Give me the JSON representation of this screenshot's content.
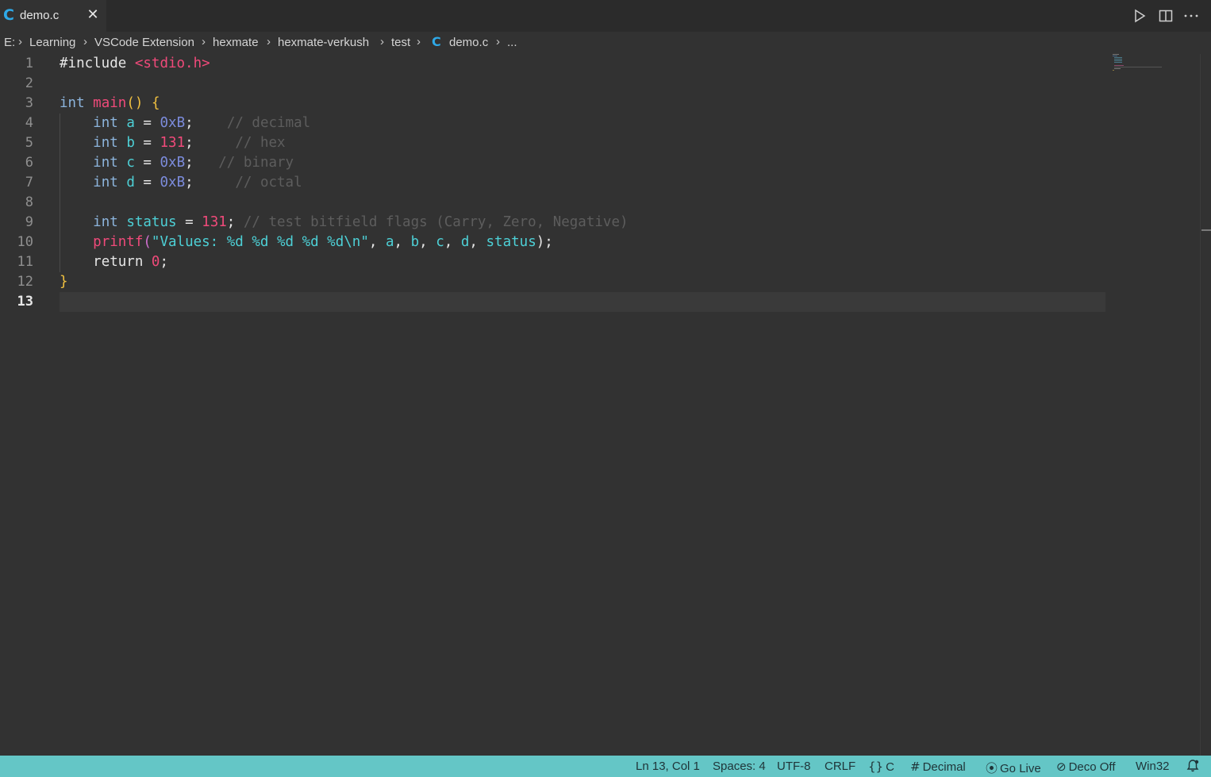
{
  "tab": {
    "icon_glyph": "C",
    "label": "demo.c",
    "close_glyph": "✕"
  },
  "breadcrumb": [
    "E:",
    "Learning",
    "VSCode Extension",
    "hexmate",
    "hexmate-verkush",
    "test",
    "demo.c",
    "..."
  ],
  "breadcrumb_file_icon": "C",
  "breadcrumb_separator": "›",
  "editor": {
    "line_numbers": [
      "1",
      "2",
      "3",
      "4",
      "5",
      "6",
      "7",
      "8",
      "9",
      "10",
      "11",
      "12",
      "13"
    ],
    "active_line": "13"
  },
  "code": {
    "l1_directive": "#include",
    "l1_header": "<stdio.h>",
    "l3_type": "int",
    "l3_fn": "main",
    "l3_parens": "()",
    "l3_brace": "{",
    "l4_type": "int",
    "l4_var": "a",
    "l4_eq": "=",
    "l4_val": "0xB",
    "l4_semi": ";",
    "l4_comment": "// decimal",
    "l5_type": "int",
    "l5_var": "b",
    "l5_eq": "=",
    "l5_val": "131",
    "l5_semi": ";",
    "l5_comment": "// hex",
    "l6_type": "int",
    "l6_var": "c",
    "l6_eq": "=",
    "l6_val": "0xB",
    "l6_semi": ";",
    "l6_comment": "// binary",
    "l7_type": "int",
    "l7_var": "d",
    "l7_eq": "=",
    "l7_val": "0xB",
    "l7_semi": ";",
    "l7_comment": "// octal",
    "l9_type": "int",
    "l9_var": "status",
    "l9_eq": "=",
    "l9_val": "131",
    "l9_semi": ";",
    "l9_comment": "// test bitfield flags (Carry, Zero, Negative)",
    "l10_fn": "printf",
    "l10_paren_open": "(",
    "l10_str": "\"Values: %d %d %d %d %d\\n\"",
    "l10_comma1": ",",
    "l10_a": "a",
    "l10_comma2": ",",
    "l10_b": "b",
    "l10_comma3": ",",
    "l10_c": "c",
    "l10_comma4": ",",
    "l10_d": "d",
    "l10_comma5": ",",
    "l10_status": "status",
    "l10_close": ");",
    "l11_return": "return",
    "l11_val": "0",
    "l11_semi": ";",
    "l12_brace": "}"
  },
  "statusbar": {
    "position": "Ln 13, Col 1",
    "spaces": "Spaces: 4",
    "encoding": "UTF-8",
    "eol": "CRLF",
    "language": "C",
    "number_format": "Decimal",
    "go_live": "Go Live",
    "deco": "Deco Off",
    "platform": "Win32"
  },
  "colors": {
    "accent_status": "#64c6c6",
    "c_icon": "#2ea9e8",
    "keyword": "#8cb4dc",
    "function": "#f04a7a",
    "variable": "#4dd0d6",
    "hex_number": "#7c8cdd",
    "comment": "#5d5d5d"
  }
}
